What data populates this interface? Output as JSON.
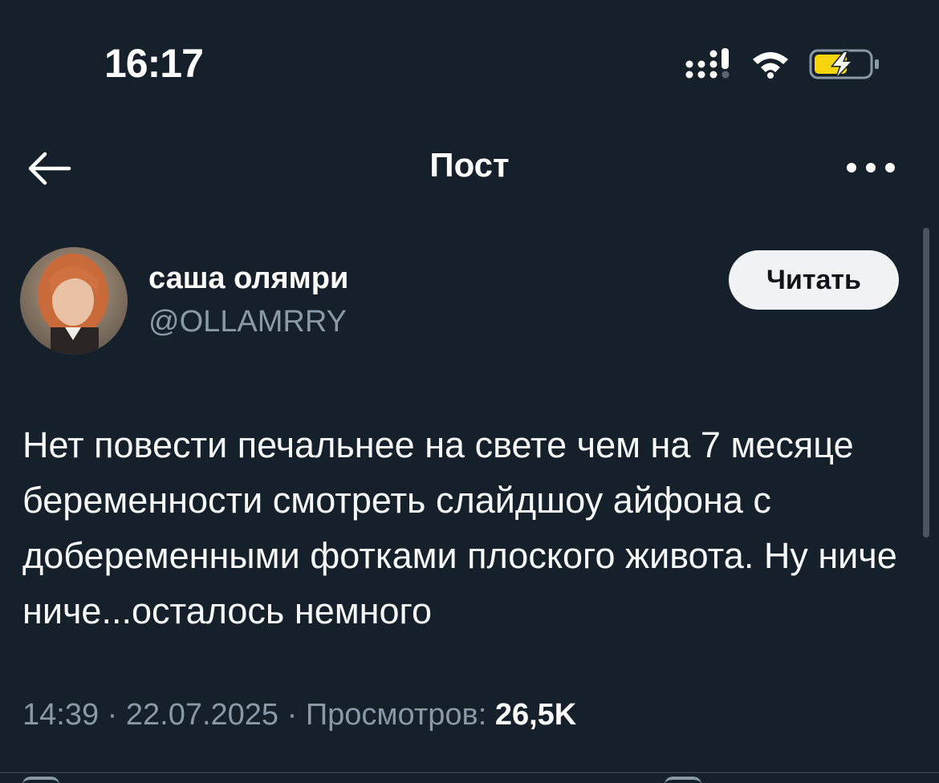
{
  "status_bar": {
    "time": "16:17",
    "icons": [
      "cellular-signal-icon",
      "wifi-icon",
      "battery-charging-icon"
    ],
    "battery_color": "#f5d50a"
  },
  "header": {
    "title": "Пост",
    "back_icon": "arrow-left-icon",
    "more_icon": "more-horizontal-icon"
  },
  "post": {
    "author": {
      "name": "саша олямри",
      "handle": "@OLLAMRRY",
      "follow_label": "Читать"
    },
    "text": "Нет повести печальнее на свете чем на 7 месяце беременности смотреть слайдшоу айфона с добеременными фотками плоского живота. Ну ниче ниче...осталось немного",
    "time": "14:39",
    "separator": "·",
    "date": "22.07.2025",
    "views_label": "Просмотров:",
    "views_count": "26,5K"
  },
  "colors": {
    "background": "#15202b",
    "text_primary": "#f7f9f9",
    "text_secondary": "#8b98a5",
    "button_bg": "#eff3f4"
  }
}
